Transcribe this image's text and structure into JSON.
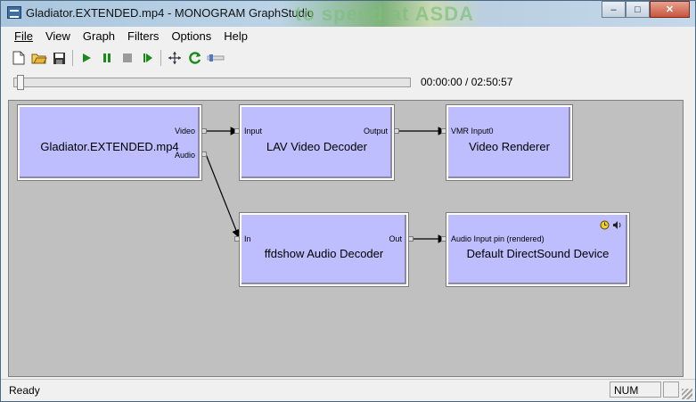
{
  "window": {
    "title": "Gladiator.EXTENDED.mp4 - MONOGRAM GraphStudio",
    "background_ad_text": "to spend at ASDA"
  },
  "caption_buttons": {
    "minimize": "–",
    "maximize": "□",
    "close": "✕"
  },
  "menu": [
    {
      "label": "File",
      "accel": "F"
    },
    {
      "label": "View",
      "accel": "V"
    },
    {
      "label": "Graph",
      "accel": ""
    },
    {
      "label": "Filters",
      "accel": ""
    },
    {
      "label": "Options",
      "accel": ""
    },
    {
      "label": "Help",
      "accel": "H"
    }
  ],
  "toolbar": {
    "new_icon": "new-file-icon",
    "open_icon": "open-folder-icon",
    "save_icon": "save-icon",
    "play_icon": "play-icon",
    "pause_icon": "pause-icon",
    "stop_icon": "stop-icon",
    "step_icon": "frame-step-icon",
    "arrange_icon": "arrange-icon",
    "refresh_icon": "refresh-icon",
    "slider_icon": "volume-slider-icon"
  },
  "seek": {
    "position_fraction": 0.0,
    "time": "00:00:00 / 02:50:57"
  },
  "graph": {
    "filters": {
      "source": {
        "name": "Gladiator.EXTENDED.mp4",
        "pins": {
          "video": "Video",
          "audio": "Audio"
        }
      },
      "video_decoder": {
        "name": "LAV Video Decoder",
        "pins": {
          "input": "Input",
          "output": "Output"
        }
      },
      "video_renderer": {
        "name": "Video Renderer",
        "pins": {
          "input": "VMR Input0"
        }
      },
      "audio_decoder": {
        "name": "ffdshow Audio Decoder",
        "pins": {
          "input": "In",
          "output": "Out"
        }
      },
      "audio_renderer": {
        "name": "Default DirectSound Device",
        "pins": {
          "input": "Audio Input pin (rendered)"
        },
        "icons": [
          "clock-icon",
          "speaker-icon"
        ]
      }
    }
  },
  "status": {
    "text": "Ready",
    "num": "NUM"
  },
  "colors": {
    "filter_fill": "#bebefe",
    "canvas": "#c0c0c0",
    "play_green": "#1a8a1a"
  }
}
